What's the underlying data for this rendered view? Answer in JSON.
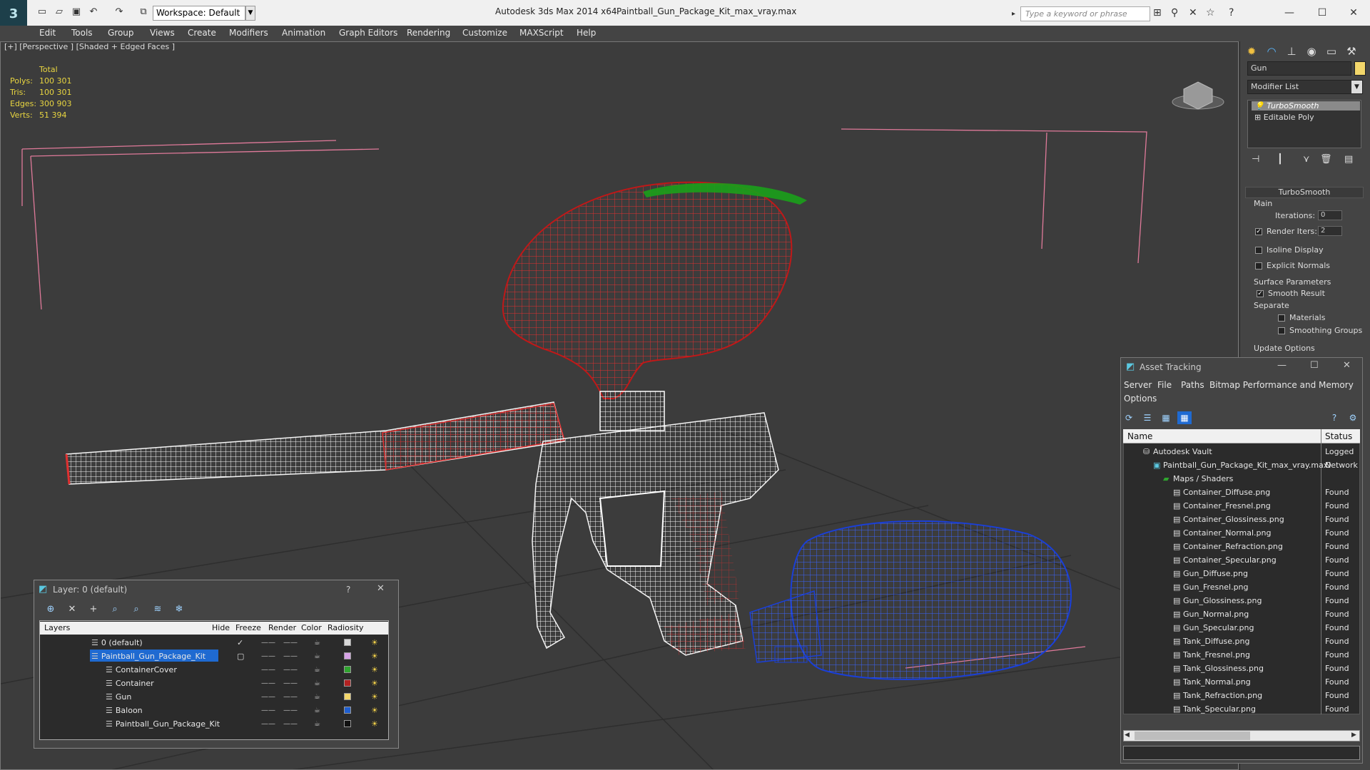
{
  "title_bar": {
    "logo_text": "3",
    "workspace": "Workspace: Default",
    "app_title": "Autodesk 3ds Max  2014 x64",
    "file_title": "Paintball_Gun_Package_Kit_max_vray.max",
    "search_placeholder": "Type a keyword or phrase"
  },
  "menu": [
    "Edit",
    "Tools",
    "Group",
    "Views",
    "Create",
    "Modifiers",
    "Animation",
    "Graph Editors",
    "Rendering",
    "Customize",
    "MAXScript",
    "Help"
  ],
  "viewport": {
    "label": "[+] [Perspective ] [Shaded + Edged Faces ]",
    "stats_header": "Total",
    "stats": [
      {
        "label": "Polys:",
        "value": "100 301"
      },
      {
        "label": "Tris:",
        "value": "100 301"
      },
      {
        "label": "Edges:",
        "value": "300 903"
      },
      {
        "label": "Verts:",
        "value": "51 394"
      }
    ]
  },
  "command_panel": {
    "object_name": "Gun",
    "object_color": "#f3d76b",
    "modifier_list": "Modifier List",
    "stack": [
      "TurboSmooth",
      "Editable Poly"
    ],
    "rollout_title": "TurboSmooth",
    "main_label": "Main",
    "iterations_label": "Iterations:",
    "iterations_value": "0",
    "render_iters_label": "Render Iters:",
    "render_iters_value": "2",
    "isoline_label": "Isoline Display",
    "explicit_normals_label": "Explicit Normals",
    "surface_params_label": "Surface Parameters",
    "smooth_result_label": "Smooth Result",
    "separate_label": "Separate",
    "materials_label": "Materials",
    "smoothing_groups_label": "Smoothing Groups",
    "update_options_label": "Update Options"
  },
  "asset_tracking": {
    "title": "Asset Tracking",
    "menu": [
      "Server",
      "File",
      "Paths",
      "Bitmap Performance and Memory",
      "Options"
    ],
    "col_name": "Name",
    "col_status": "Status",
    "rows": [
      {
        "name": "Autodesk Vault",
        "status": "Logged O",
        "indent": 1,
        "icon": "vault-icon"
      },
      {
        "name": "Paintball_Gun_Package_Kit_max_vray.max",
        "status": "Network",
        "indent": 2,
        "icon": "max-file-icon"
      },
      {
        "name": "Maps / Shaders",
        "status": "",
        "indent": 3,
        "icon": "maps-icon"
      },
      {
        "name": "Container_Diffuse.png",
        "status": "Found",
        "indent": 4,
        "icon": "bitmap-icon"
      },
      {
        "name": "Container_Fresnel.png",
        "status": "Found",
        "indent": 4,
        "icon": "bitmap-icon"
      },
      {
        "name": "Container_Glossiness.png",
        "status": "Found",
        "indent": 4,
        "icon": "bitmap-icon"
      },
      {
        "name": "Container_Normal.png",
        "status": "Found",
        "indent": 4,
        "icon": "bitmap-icon"
      },
      {
        "name": "Container_Refraction.png",
        "status": "Found",
        "indent": 4,
        "icon": "bitmap-icon"
      },
      {
        "name": "Container_Specular.png",
        "status": "Found",
        "indent": 4,
        "icon": "bitmap-icon"
      },
      {
        "name": "Gun_Diffuse.png",
        "status": "Found",
        "indent": 4,
        "icon": "bitmap-icon"
      },
      {
        "name": "Gun_Fresnel.png",
        "status": "Found",
        "indent": 4,
        "icon": "bitmap-icon"
      },
      {
        "name": "Gun_Glossiness.png",
        "status": "Found",
        "indent": 4,
        "icon": "bitmap-icon"
      },
      {
        "name": "Gun_Normal.png",
        "status": "Found",
        "indent": 4,
        "icon": "bitmap-icon"
      },
      {
        "name": "Gun_Specular.png",
        "status": "Found",
        "indent": 4,
        "icon": "bitmap-icon"
      },
      {
        "name": "Tank_Diffuse.png",
        "status": "Found",
        "indent": 4,
        "icon": "bitmap-icon"
      },
      {
        "name": "Tank_Fresnel.png",
        "status": "Found",
        "indent": 4,
        "icon": "bitmap-icon"
      },
      {
        "name": "Tank_Glossiness.png",
        "status": "Found",
        "indent": 4,
        "icon": "bitmap-icon"
      },
      {
        "name": "Tank_Normal.png",
        "status": "Found",
        "indent": 4,
        "icon": "bitmap-icon"
      },
      {
        "name": "Tank_Refraction.png",
        "status": "Found",
        "indent": 4,
        "icon": "bitmap-icon"
      },
      {
        "name": "Tank_Specular.png",
        "status": "Found",
        "indent": 4,
        "icon": "bitmap-icon"
      }
    ]
  },
  "layer_window": {
    "title": "Layer: 0 (default)",
    "help": "?",
    "columns": [
      "Layers",
      "Hide",
      "Freeze",
      "Render",
      "Color",
      "Radiosity"
    ],
    "rows": [
      {
        "name": "0 (default)",
        "color": "#d9d9d9",
        "indent": 1,
        "selected": false,
        "current": true
      },
      {
        "name": "Paintball_Gun_Package_Kit",
        "color": "#d6a3e6",
        "indent": 1,
        "selected": true,
        "current": false
      },
      {
        "name": "ContainerCover",
        "color": "#2fa42f",
        "indent": 2,
        "selected": false,
        "current": false
      },
      {
        "name": "Container",
        "color": "#b22222",
        "indent": 2,
        "selected": false,
        "current": false
      },
      {
        "name": "Gun",
        "color": "#f3d76b",
        "indent": 2,
        "selected": false,
        "current": false
      },
      {
        "name": "Baloon",
        "color": "#1f5fd0",
        "indent": 2,
        "selected": false,
        "current": false
      },
      {
        "name": "Paintball_Gun_Package_Kit",
        "color": "#111111",
        "indent": 2,
        "selected": false,
        "current": false
      }
    ]
  },
  "colors": {
    "hopper_wire": "#cc1a1a",
    "hopper_lid_wire": "#1aa01a",
    "tank_wire": "#1a3fd8",
    "gun_wire": "#ffffff",
    "stats_text": "#e8d540",
    "selection": "#1f6ad1"
  }
}
